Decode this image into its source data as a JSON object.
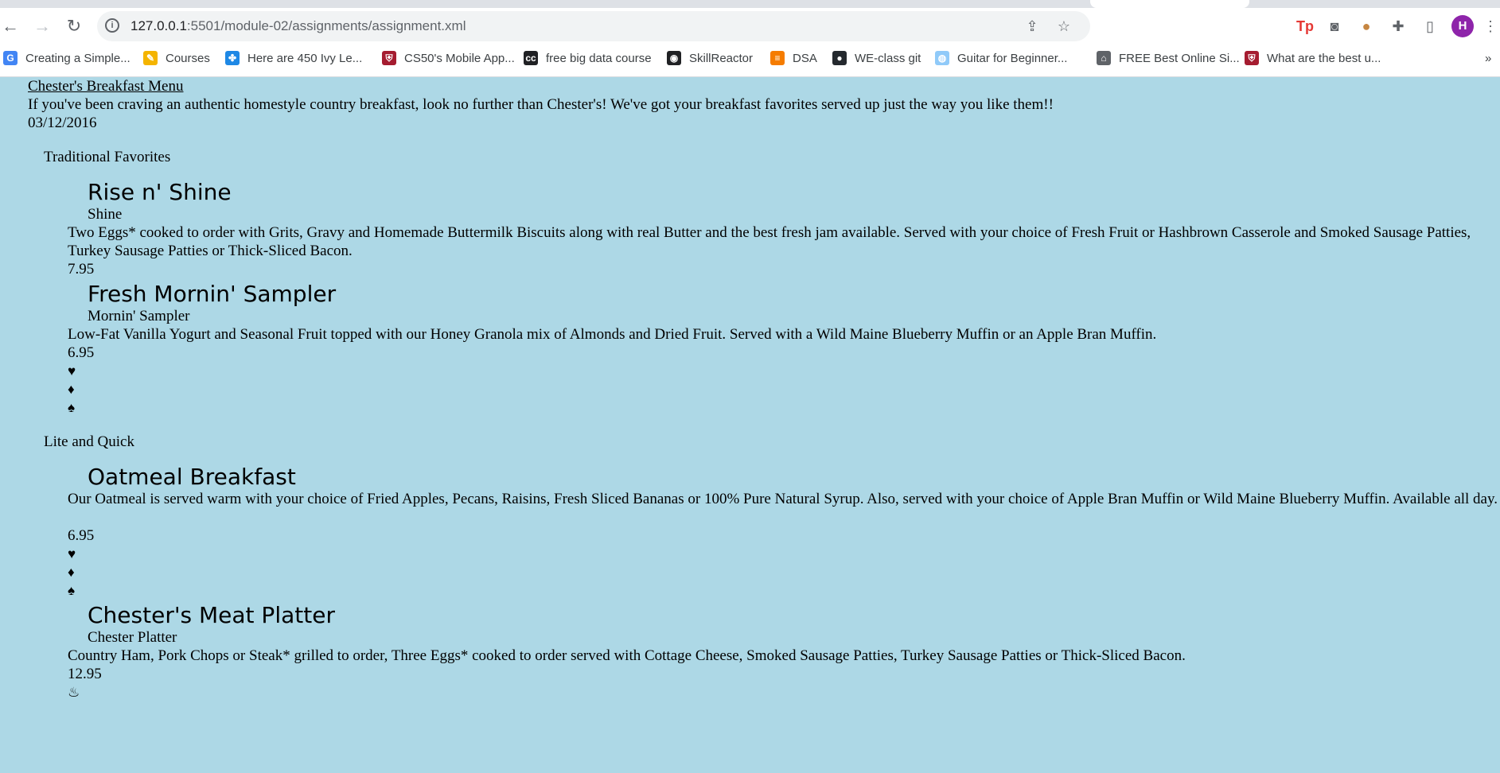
{
  "browser": {
    "url_host": "127.0.0.1",
    "url_path": ":5501/module-02/assignments/assignment.xml",
    "avatar_letter": "H",
    "bookmarks": [
      {
        "label": "Creating a Simple...",
        "icon": "google-icon",
        "color": "#4285f4",
        "glyph": "G"
      },
      {
        "label": "Courses",
        "icon": "pencil-icon",
        "color": "#f4b400",
        "glyph": "✎"
      },
      {
        "label": "Here are 450 Ivy Le...",
        "icon": "flower-icon",
        "color": "#1e88e5",
        "glyph": "✤"
      },
      {
        "label": "CS50's Mobile App...",
        "icon": "harvard-shield-icon",
        "color": "#a51c30",
        "glyph": "⛨"
      },
      {
        "label": "free big data course",
        "icon": "cc-icon",
        "color": "#202124",
        "glyph": "cc"
      },
      {
        "label": "SkillReactor",
        "icon": "skillreactor-icon",
        "color": "#202124",
        "glyph": "◉"
      },
      {
        "label": "DSA",
        "icon": "dsa-icon",
        "color": "#f57c00",
        "glyph": "≡"
      },
      {
        "label": "WE-class git",
        "icon": "github-icon",
        "color": "#24292e",
        "glyph": "●"
      },
      {
        "label": "Guitar for Beginner...",
        "icon": "globe-icon",
        "color": "#90caf9",
        "glyph": "◍"
      },
      {
        "label": "FREE Best Online Si...",
        "icon": "graduation-cap-icon",
        "color": "#5f6368",
        "glyph": "⌂"
      },
      {
        "label": "What are the best u...",
        "icon": "harvard-shield-icon",
        "color": "#a51c30",
        "glyph": "⛨"
      }
    ],
    "overflow_label": "»"
  },
  "menu": {
    "title": "Chester's Breakfast Menu",
    "intro": "If you've been craving an authentic homestyle country breakfast, look no further than Chester's! We've got your breakfast favorites served up just the way you like them!!",
    "date": "03/12/2016",
    "categories": [
      {
        "name": "Traditional Favorites",
        "items": [
          {
            "name": "Rise n' Shine",
            "short": "Shine",
            "description": "Two Eggs* cooked to order with Grits, Gravy and Homemade Buttermilk Biscuits along with real Butter and the best fresh jam available. Served with your choice of Fresh Fruit or Hashbrown Casserole and Smoked Sausage Patties, Turkey Sausage Patties or Thick-Sliced Bacon.",
            "price": "7.95",
            "symbols": []
          },
          {
            "name": "Fresh Mornin' Sampler",
            "short": "Mornin' Sampler",
            "description": "Low-Fat Vanilla Yogurt and Seasonal Fruit topped with our Honey Granola mix of Almonds and Dried Fruit. Served with a Wild Maine Blueberry Muffin or an Apple Bran Muffin.",
            "price": "6.95",
            "symbols": [
              "♥",
              "♦",
              "♠"
            ]
          }
        ]
      },
      {
        "name": "Lite and Quick",
        "items": [
          {
            "name": "Oatmeal Breakfast",
            "short": "",
            "description": "Our Oatmeal is served warm with your choice of Fried Apples, Pecans, Raisins, Fresh Sliced Bananas or 100% Pure Natural Syrup. Also, served with your choice of Apple Bran Muffin or Wild Maine Blueberry Muffin. Available all day.",
            "price": "6.95",
            "symbols": [
              "♥",
              "♦",
              "♠"
            ]
          },
          {
            "name": "Chester's Meat Platter",
            "short": "Chester Platter",
            "description": "Country Ham, Pork Chops or Steak* grilled to order, Three Eggs* cooked to order served with Cottage Cheese, Smoked Sausage Patties, Turkey Sausage Patties or Thick-Sliced Bacon.",
            "price": "12.95",
            "symbols": [
              "♨"
            ]
          }
        ]
      }
    ]
  }
}
